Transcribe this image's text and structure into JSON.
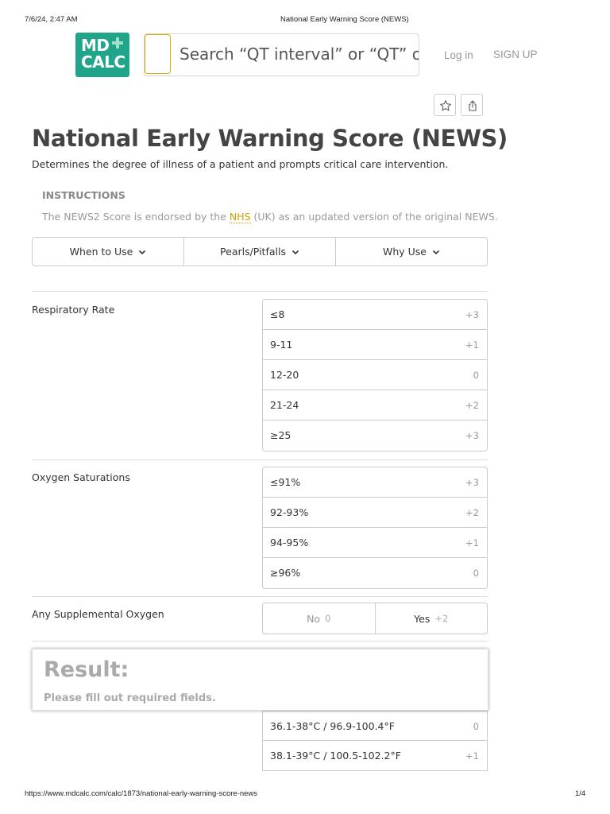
{
  "print_header": {
    "datetime": "7/6/24, 2:47 AM",
    "page_title": "National Early Warning Score (NEWS)"
  },
  "print_footer": {
    "url": "https://www.mdcalc.com/calc/1873/national-early-warning-score-news",
    "page": "1/4"
  },
  "logo": {
    "line1": "MD",
    "line2": "CALC"
  },
  "search": {
    "placeholder": "Search “QT interval” or “QT” or"
  },
  "nav": {
    "login": "Log in",
    "signup": "SIGN UP"
  },
  "actions": {
    "favorite_icon": "star-icon",
    "share_icon": "share-icon"
  },
  "title": "National Early Warning Score (NEWS)",
  "subtitle": "Determines the degree of illness of a patient and prompts critical care intervention.",
  "instructions": {
    "heading": "INSTRUCTIONS",
    "text_before": "The NEWS2 Score is endorsed by the ",
    "link": "NHS",
    "text_after": " (UK) as an updated version of the original NEWS."
  },
  "tabs": [
    {
      "label": "When to Use"
    },
    {
      "label": "Pearls/Pitfalls"
    },
    {
      "label": "Why Use"
    }
  ],
  "respiratory": {
    "label": "Respiratory Rate",
    "options": [
      {
        "label": "≤8",
        "score": "+3"
      },
      {
        "label": "9-11",
        "score": "+1"
      },
      {
        "label": "12-20",
        "score": "0"
      },
      {
        "label": "21-24",
        "score": "+2"
      },
      {
        "label": "≥25",
        "score": "+3"
      }
    ]
  },
  "oxygen_sat": {
    "label": "Oxygen Saturations",
    "options": [
      {
        "label": "≤91%",
        "score": "+3"
      },
      {
        "label": "92-93%",
        "score": "+2"
      },
      {
        "label": "94-95%",
        "score": "+1"
      },
      {
        "label": "≥96%",
        "score": "0"
      }
    ]
  },
  "supplemental_o2": {
    "label": "Any Supplemental Oxygen",
    "no_label": "No",
    "no_score": "0",
    "yes_label": "Yes",
    "yes_score": "+2"
  },
  "result": {
    "heading": "Result:",
    "text": "Please fill out required fields."
  },
  "temperature": {
    "options": [
      {
        "label": "36.1-38°C / 96.9-100.4°F",
        "score": "0"
      },
      {
        "label": "38.1-39°C / 100.5-102.2°F",
        "score": "+1"
      }
    ]
  },
  "colors": {
    "brand": "#20a58a",
    "link": "#c9a200"
  }
}
